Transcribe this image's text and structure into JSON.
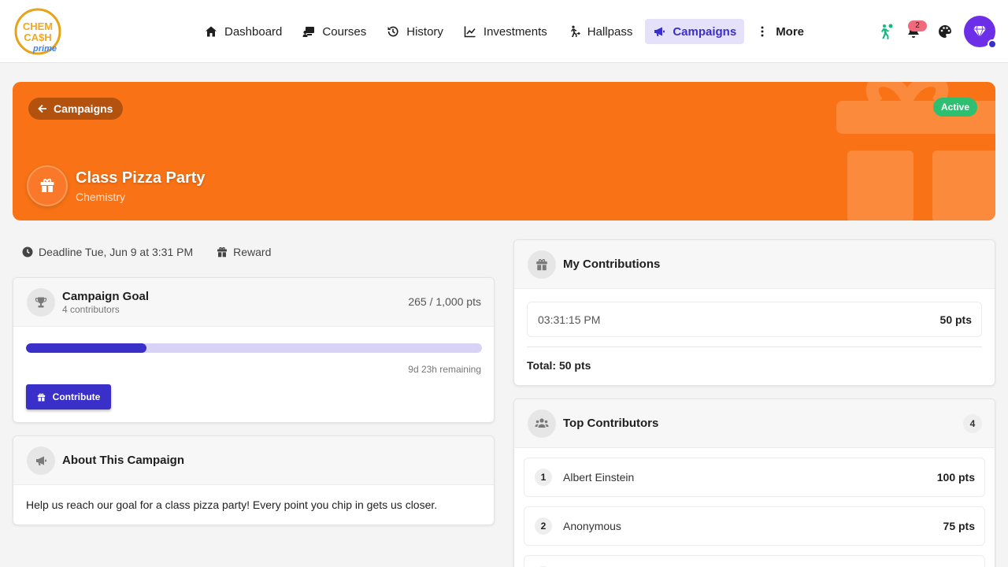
{
  "app": {
    "logo_text_top": "CHEM",
    "logo_text_bottom": "CA$H",
    "logo_text_tag": "prime"
  },
  "nav": {
    "items": [
      {
        "label": "Dashboard",
        "icon": "home-icon"
      },
      {
        "label": "Courses",
        "icon": "courses-icon"
      },
      {
        "label": "History",
        "icon": "history-icon"
      },
      {
        "label": "Investments",
        "icon": "chart-line-icon"
      },
      {
        "label": "Hallpass",
        "icon": "walking-person-icon"
      },
      {
        "label": "Campaigns",
        "icon": "megaphone-icon",
        "active": true
      },
      {
        "label": "More",
        "icon": "more-vertical-icon"
      }
    ]
  },
  "header": {
    "notification_count": "2",
    "hallpass_color": "#10b981",
    "avatar_color": "#6d2ee8"
  },
  "campaign": {
    "back_label": "Campaigns",
    "status": "Active",
    "title": "Class Pizza Party",
    "subject": "Chemistry",
    "banner_color": "#f97316",
    "deadline": "Deadline Tue, Jun 9 at 3:31 PM",
    "reward_label": "Reward"
  },
  "goal": {
    "title": "Campaign Goal",
    "contributors": "4 contributors",
    "amount": "265 / 1,000 pts",
    "progress_fraction": 0.265,
    "remaining": "9d 23h remaining",
    "contribute_label": "Contribute"
  },
  "about": {
    "title": "About This Campaign",
    "text": "Help us reach our goal for a class pizza party! Every point you chip in gets us closer."
  },
  "my_contributions": {
    "title": "My Contributions",
    "entries": [
      {
        "time": "03:31:15 PM",
        "points": "50 pts"
      }
    ],
    "total": "Total: 50 pts"
  },
  "top_contributors": {
    "title": "Top Contributors",
    "count": "4",
    "rows": [
      {
        "rank": "1",
        "name": "Albert Einstein",
        "points": "100 pts"
      },
      {
        "rank": "2",
        "name": "Anonymous",
        "points": "75 pts"
      },
      {
        "rank": "3",
        "name": "",
        "points": ""
      }
    ]
  },
  "colors": {
    "accent": "#3b2fc9",
    "accent_light": "#e5e1fb",
    "success": "#2fbf71"
  }
}
